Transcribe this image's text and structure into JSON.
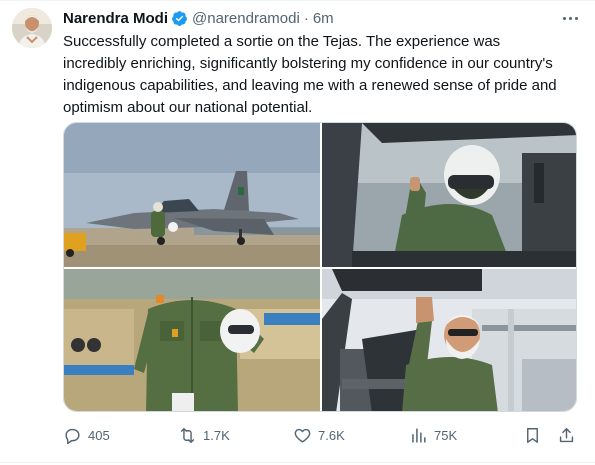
{
  "tweet": {
    "author_name": "Narendra Modi",
    "author_handle": "@narendramodi",
    "separator": "·",
    "time": "6m",
    "text_lines": [
      "Successfully completed a sortie on the Tejas. The experience was",
      "incredibly enriching, significantly bolstering my confidence in our country's",
      "indigenous capabilities, and leaving me with a renewed sense of pride and",
      "optimism about our national potential."
    ],
    "media": [
      {
        "icon": "photo-tejas-on-runway"
      },
      {
        "icon": "photo-pilot-in-cockpit"
      },
      {
        "icon": "photo-flight-suit-closeup"
      },
      {
        "icon": "photo-waving-from-cockpit"
      }
    ],
    "actions": {
      "replies": "405",
      "reposts": "1.7K",
      "likes": "7.6K",
      "views": "75K"
    }
  },
  "colors": {
    "verified": "#1d9bf0",
    "text": "#0f1419",
    "secondary": "#536471",
    "divider": "#eff3f4"
  }
}
